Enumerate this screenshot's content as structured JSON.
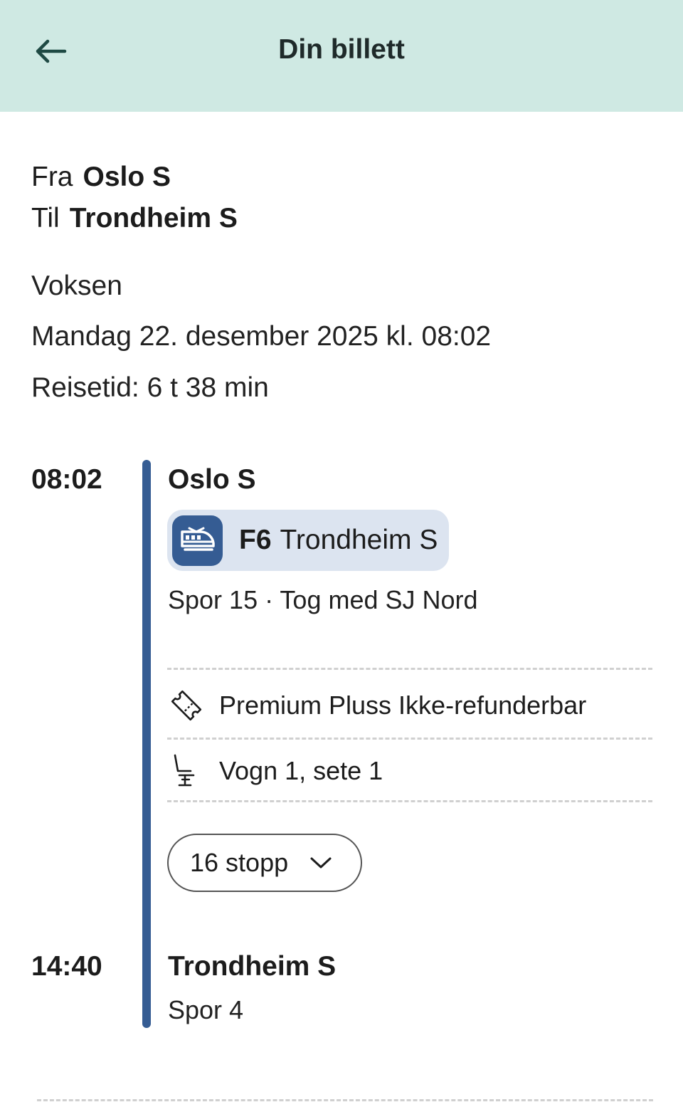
{
  "header": {
    "title": "Din billett",
    "back_icon": "arrow-left-icon",
    "background": "#cfe9e3"
  },
  "route": {
    "from_label": "Fra",
    "from_value": "Oslo S",
    "to_label": "Til",
    "to_value": "Trondheim S"
  },
  "passenger": "Voksen",
  "departure_datetime": "Mandag 22. desember 2025 kl. 08:02",
  "travel_time": "Reisetid: 6 t 38 min",
  "journey": {
    "departure_time": "08:02",
    "departure_station": "Oslo S",
    "train_line": "F6",
    "train_destination": "Trondheim S",
    "train_icon": "train-icon",
    "platform_operator": "Spor 15 · Tog med SJ Nord",
    "ticket_type": "Premium Pluss Ikke-refunderbar",
    "ticket_icon": "ticket-icon",
    "seat": "Vogn 1, sete 1",
    "seat_icon": "seat-icon",
    "stops_label": "16 stopp",
    "stops_icon": "chevron-down-icon",
    "arrival_time": "14:40",
    "arrival_station": "Trondheim S",
    "arrival_platform": "Spor 4"
  },
  "colors": {
    "accent": "#355c93",
    "chip_bg": "#dce4f0"
  }
}
